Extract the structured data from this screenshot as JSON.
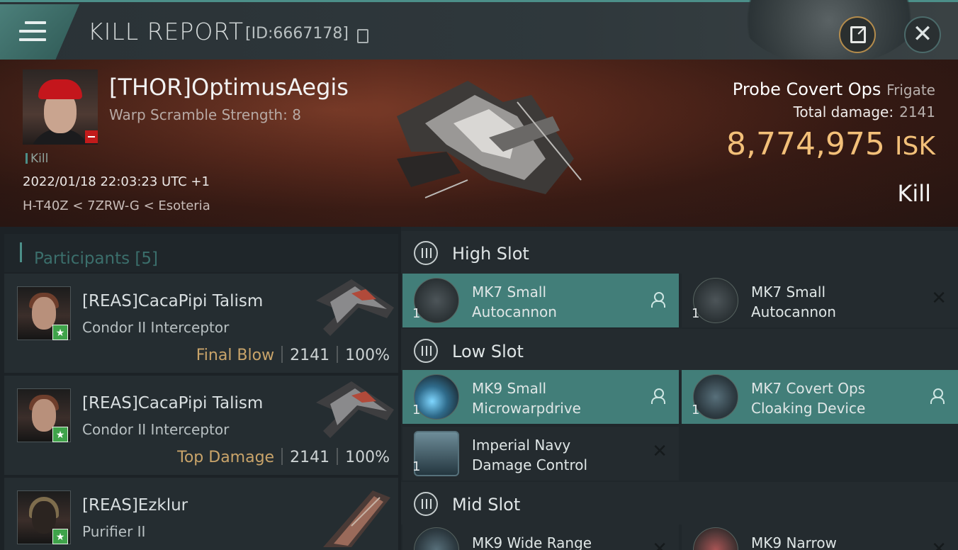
{
  "header": {
    "title": "KILL REPORT",
    "report_id": "[ID:6667178]"
  },
  "victim": {
    "name": "[THOR]OptimusAegis",
    "warp_scramble": "Warp Scramble Strength: 8",
    "tag": "Kill",
    "datetime": "2022/01/18 22:03:23 UTC +1",
    "location": "H-T40Z < 7ZRW-G < Esoteria",
    "ship_name": "Probe Covert Ops",
    "ship_class": "Frigate",
    "total_damage_label": "Total damage:",
    "total_damage": "2141",
    "isk_value": "8,774,975",
    "isk_unit": "ISK",
    "result": "Kill"
  },
  "participants": {
    "title": "Participants",
    "count": "[5]",
    "items": [
      {
        "name": "[REAS]CacaPipi Talism",
        "ship": "Condor II Interceptor",
        "label": "Final Blow",
        "damage": "2141",
        "percent": "100%"
      },
      {
        "name": "[REAS]CacaPipi Talism",
        "ship": "Condor II Interceptor",
        "label": "Top Damage",
        "damage": "2141",
        "percent": "100%"
      },
      {
        "name": "[REAS]Ezklur",
        "ship": "Purifier II",
        "label": "",
        "damage": "",
        "percent": ""
      }
    ]
  },
  "fitting": {
    "high_slot": {
      "label": "High Slot",
      "modules": [
        {
          "qty": "1",
          "name_line1": "MK7 Small",
          "name_line2": "Autocannon",
          "status": "dropped"
        },
        {
          "qty": "1",
          "name_line1": "MK7 Small",
          "name_line2": "Autocannon",
          "status": "destroyed"
        }
      ]
    },
    "low_slot": {
      "label": "Low Slot",
      "modules": [
        {
          "qty": "1",
          "name_line1": "MK9 Small",
          "name_line2": "Microwarpdrive",
          "status": "dropped"
        },
        {
          "qty": "1",
          "name_line1": "MK7 Covert Ops",
          "name_line2": "Cloaking Device",
          "status": "dropped"
        },
        {
          "qty": "1",
          "name_line1": "Imperial Navy",
          "name_line2": "Damage Control",
          "status": "destroyed"
        }
      ]
    },
    "mid_slot": {
      "label": "Mid Slot",
      "modules": [
        {
          "qty": "",
          "name_line1": "MK9 Wide Range",
          "name_line2": "",
          "status": "destroyed"
        },
        {
          "qty": "",
          "name_line1": "MK9 Narrow",
          "name_line2": "",
          "status": "destroyed"
        }
      ]
    }
  },
  "icons": {
    "close": "✕",
    "destroyed": "✕",
    "star": "★"
  },
  "colors": {
    "accent": "#4c8f89",
    "isk": "#f3c079",
    "final_blow": "#c9a46a",
    "module_active": "#427e79"
  }
}
